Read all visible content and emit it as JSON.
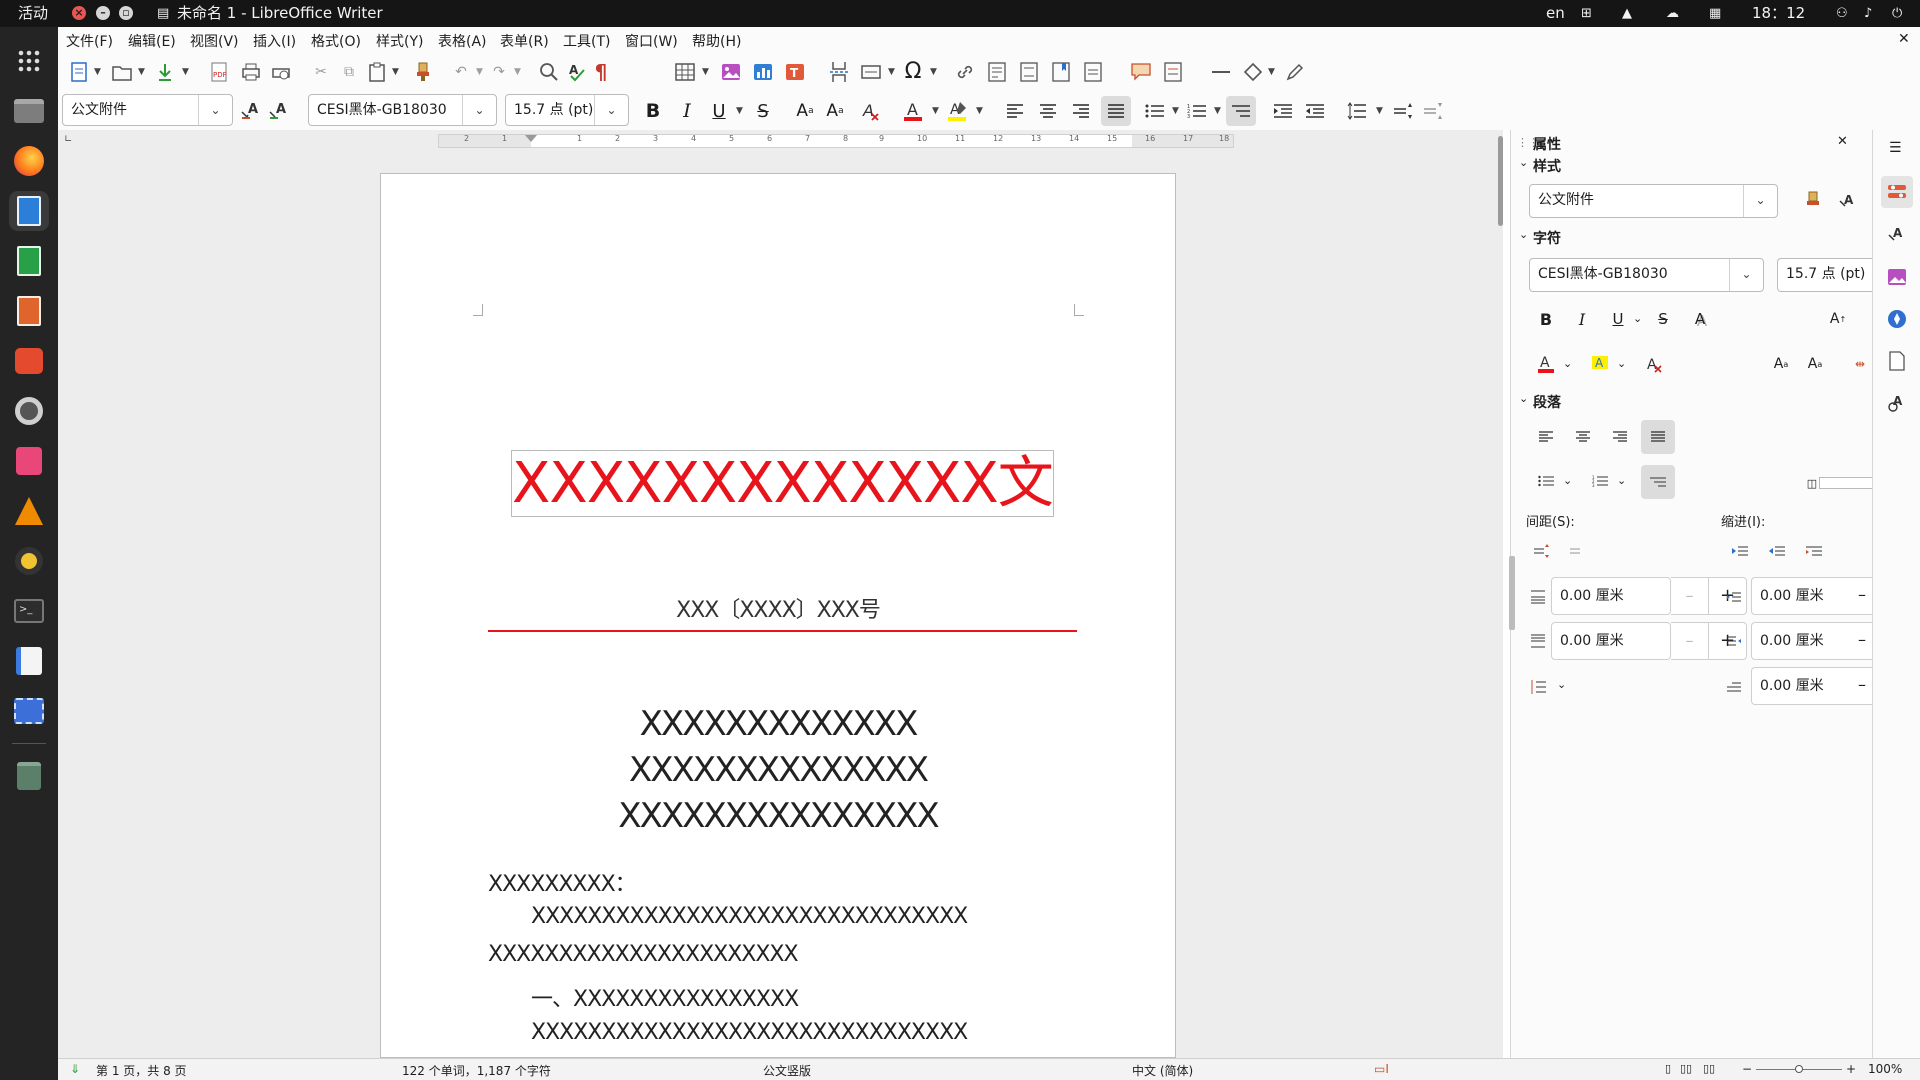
{
  "topbar": {
    "activities": "活动",
    "window_title": "未命名 1 - LibreOffice Writer",
    "lang": "en",
    "clock": "18：12"
  },
  "menu": [
    "文件(F)",
    "编辑(E)",
    "视图(V)",
    "插入(I)",
    "格式(O)",
    "样式(Y)",
    "表格(A)",
    "表单(R)",
    "工具(T)",
    "窗口(W)",
    "帮助(H)"
  ],
  "toolbar": {
    "paragraph_style": "公文附件",
    "font_name": "CESI黑体-GB18030",
    "font_size": "15.7 点 (pt)"
  },
  "ruler": {
    "ticks": [
      "2",
      "1",
      "1",
      "2",
      "3",
      "4",
      "5",
      "6",
      "7",
      "8",
      "9",
      "10",
      "11",
      "12",
      "13",
      "14",
      "15",
      "16",
      "17",
      "18"
    ]
  },
  "document": {
    "header_title": "XXXXXXXXXXXXX文件",
    "doc_number": "XXX〔XXXX〕XXX号",
    "title_lines": [
      "XXXXXXXXXXXXX",
      "XXXXXXXXXXXXXX",
      "XXXXXXXXXXXXXXX"
    ],
    "salutation": "XXXXXXXXX：",
    "body_lines": [
      "XXXXXXXXXXXXXXXXXXXXXXXXXXXXXXX",
      "XXXXXXXXXXXXXXXXXXXXXX",
      "一、XXXXXXXXXXXXXXXX",
      "XXXXXXXXXXXXXXXXXXXXXXXXXXXXXXX"
    ]
  },
  "sidebar": {
    "title": "属性",
    "style_section": "样式",
    "style_value": "公文附件",
    "char_section": "字符",
    "font_name": "CESI黑体-GB18030",
    "font_size": "15.7 点 (pt)",
    "para_section": "段落",
    "spacing_label": "间距(S):",
    "indent_label": "缩进(I):",
    "above_spacing": "0.00 厘米",
    "below_spacing": "0.00 厘米",
    "before_indent": "0.00 厘米",
    "after_indent": "0.00 厘米",
    "first_line_indent": "0.00 厘米"
  },
  "statusbar": {
    "page": "第 1 页，共 8 页",
    "words": "122 个单词，1,187 个字符",
    "page_style": "公文竖版",
    "language": "中文 (简体)",
    "zoom": "100%"
  },
  "colors": {
    "accent_red": "#e8141c",
    "dock_bg": "#242424",
    "topbar_bg": "#151515"
  }
}
